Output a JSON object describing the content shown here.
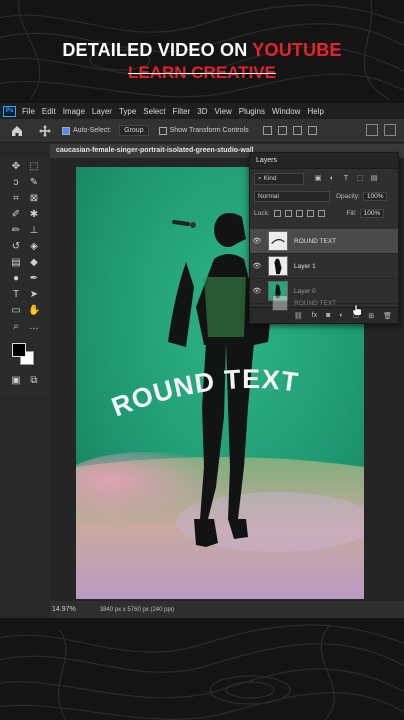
{
  "banner": {
    "line1_prefix": "DETAILED VIDEO ON ",
    "line1_accent": "YOUTUBE",
    "line2": "LEARN CREATIVE"
  },
  "app": {
    "logo": "Ps",
    "menu": [
      "File",
      "Edit",
      "Image",
      "Layer",
      "Type",
      "Select",
      "Filter",
      "3D",
      "View",
      "Plugins",
      "Window",
      "Help"
    ]
  },
  "options_bar": {
    "auto_select_label": "Auto-Select:",
    "auto_select_checked": true,
    "target": "Group",
    "show_transform_label": "Show Transform Controls",
    "show_transform_checked": false
  },
  "document": {
    "tab_title": "caucasian-female-singer-portrait-isolated-green-studio-wall",
    "zoom": "14.97%",
    "info": "3840 px x 5760 px (240 ppi)",
    "curved_text": "ROUND TEXT"
  },
  "layers_panel": {
    "title": "Layers",
    "kind_filter": "Kind",
    "blend_mode": "Normal",
    "opacity_label": "Opacity:",
    "opacity_value": "100%",
    "lock_label": "Lock:",
    "fill_label": "Fill:",
    "fill_value": "100%",
    "layers": [
      {
        "name": "ROUND TEXT",
        "visible": true,
        "selected": true
      },
      {
        "name": "Layer 1",
        "visible": true,
        "selected": false
      },
      {
        "name": "Layer 0",
        "visible": true,
        "selected": false
      }
    ],
    "drag_ghost_name": "ROUND TEXT",
    "footer_icons": [
      "link-icon",
      "fx-icon",
      "mask-icon",
      "adjustment-icon",
      "group-icon",
      "new-layer-icon",
      "trash-icon"
    ]
  },
  "colors": {
    "accent_red": "#e8222b",
    "background": "#141414",
    "ps_blue": "#31a8ff",
    "photo_green": "#1f9a73"
  }
}
